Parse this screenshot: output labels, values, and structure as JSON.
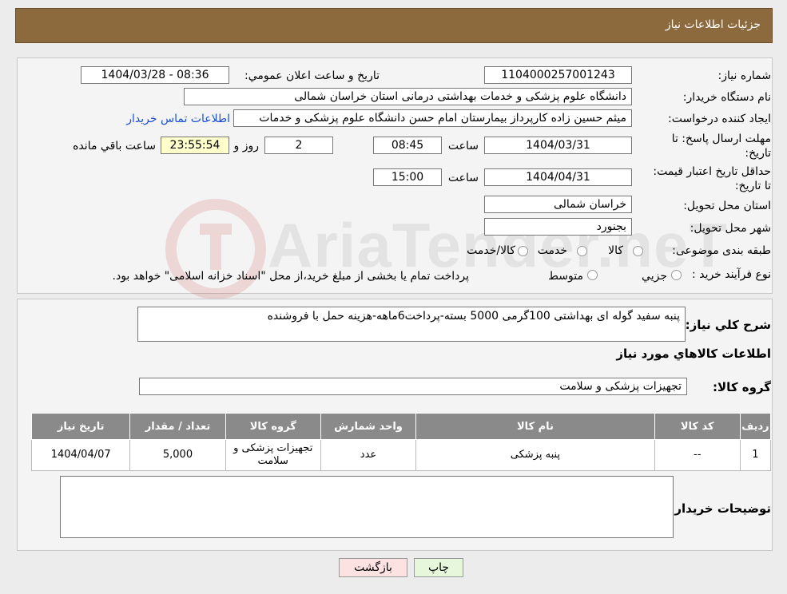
{
  "header": {
    "title": "جزئیات اطلاعات نیاز"
  },
  "form": {
    "need_number_label": "شماره نیاز:",
    "need_number": "1104000257001243",
    "announce_label": "تاریخ و ساعت اعلان عمومي:",
    "announce_value": "1404/03/28 - 08:36",
    "buyer_org_label": "نام دستگاه خریدار:",
    "buyer_org": "دانشگاه علوم پزشکی و خدمات بهداشتی درمانی استان خراسان شمالی",
    "creator_label": "ایجاد کننده درخواست:",
    "creator": "میثم  حسین زاده  کارپرداز بیمارستان امام حسن دانشگاه علوم پزشکی و خدمات",
    "contact_link": "اطلاعات تماس خریدار",
    "deadline_label": "مهلت ارسال پاسخ: تا تاریخ:",
    "deadline_date": "1404/03/31",
    "time_label": "ساعت",
    "deadline_time": "08:45",
    "days_value": "2",
    "days_label": "روز و",
    "remaining_time": "23:55:54",
    "remaining_label": "ساعت باقي مانده",
    "validity_label": "حداقل تاریخ اعتبار قیمت: تا تاریخ:",
    "validity_date": "1404/04/31",
    "validity_time": "15:00",
    "province_label": "استان محل تحویل:",
    "province": "خراسان شمالی",
    "city_label": "شهر محل تحویل:",
    "city": "بجنورد",
    "category_label": "طبقه بندی موضوعی:",
    "category_options": [
      "کالا",
      "خدمت",
      "کالا/خدمت"
    ],
    "process_label": "نوع فرآیند خرید :",
    "process_options": [
      "جزیي",
      "متوسط"
    ],
    "process_note": "پرداخت تمام یا بخشی از مبلغ خرید،از محل \"اسناد خزانه اسلامی\" خواهد بود."
  },
  "details": {
    "summary_label": "شرح کلي نیاز:",
    "summary": "پنبه سفید گوله ای بهداشتی 100گرمی 5000 بسته-پرداخت6ماهه-هزینه حمل با فروشنده",
    "items_heading": "اطلاعات کالاهاي مورد نیاز",
    "group_label": "گروه کالا:",
    "group_value": "تجهیزات پزشکی و سلامت",
    "table": {
      "headers": [
        "ردیف",
        "کد کالا",
        "نام کالا",
        "واحد شمارش",
        "گروه کالا",
        "تعداد / مقدار",
        "تاریخ نیاز"
      ],
      "rows": [
        [
          "1",
          "--",
          "پنبه پزشکی",
          "عدد",
          "تجهیزات پزشکی و سلامت",
          "5,000",
          "1404/04/07"
        ]
      ]
    },
    "buyer_notes_label": "توضیحات خریدار:",
    "buyer_notes": ""
  },
  "buttons": {
    "print": "چاپ",
    "back": "بازگشت"
  },
  "watermark": "AriaTender.neT",
  "colors": {
    "header_bg": "#8c6a3e",
    "table_header_bg": "#8a8a8a",
    "link": "#1a4fd6",
    "print_bg": "#e6f7dc",
    "back_bg": "#fde2e2"
  }
}
